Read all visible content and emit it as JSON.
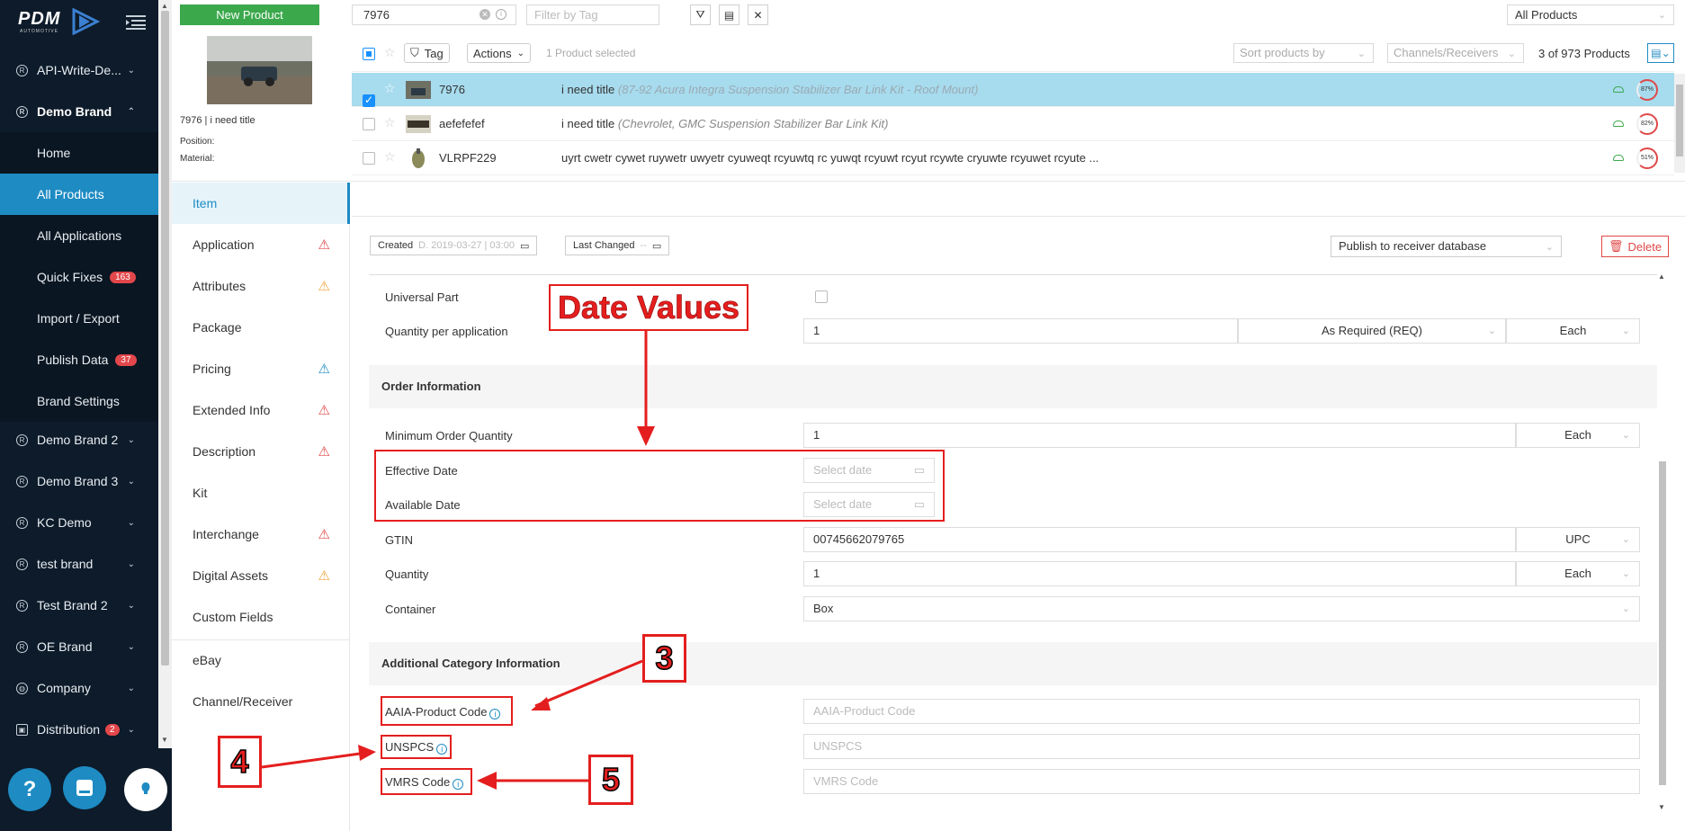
{
  "sidebar": {
    "logo": "PDM",
    "logo_sub": "AUTOMOTIVE",
    "brands": [
      {
        "label": "API-Write-De..."
      },
      {
        "label": "Demo Brand"
      },
      {
        "label": "Demo Brand 2"
      },
      {
        "label": "Demo Brand 3"
      },
      {
        "label": "KC Demo"
      },
      {
        "label": "test brand"
      },
      {
        "label": "Test Brand 2"
      },
      {
        "label": "OE Brand"
      },
      {
        "label": "Company"
      },
      {
        "label": "Distribution",
        "badge": "2"
      }
    ],
    "sub_items": [
      {
        "label": "Home"
      },
      {
        "label": "All Products"
      },
      {
        "label": "All Applications"
      },
      {
        "label": "Quick Fixes",
        "badge": "163"
      },
      {
        "label": "Import / Export"
      },
      {
        "label": "Publish Data",
        "badge": "37"
      },
      {
        "label": "Brand Settings"
      }
    ]
  },
  "topbar": {
    "new_product": "New Product",
    "search_value": "7976",
    "tag_placeholder": "Filter by Tag",
    "view_select": "All Products"
  },
  "product_panel": {
    "title": "7976 | i need title",
    "position_label": "Position:",
    "material_label": "Material:"
  },
  "list_header": {
    "tag_btn": "Tag",
    "actions_btn": "Actions",
    "selected_text": "1 Product selected",
    "sort_placeholder": "Sort products by",
    "channels_placeholder": "Channels/Receivers",
    "count_text": "3 of 973 Products"
  },
  "products": [
    {
      "part": "7976",
      "title": "i need title",
      "subtitle": "(87-92 Acura Integra Suspension Stabilizer Bar Link Kit - Roof Mount)",
      "percent": "87%",
      "selected": true
    },
    {
      "part": "aefefefef",
      "title": "i need title",
      "subtitle": "(Chevrolet, GMC Suspension Stabilizer Bar Link Kit)",
      "percent": "82%",
      "selected": false
    },
    {
      "part": "VLRPF229",
      "title": "uyrt cwetr cywet ruywetr uwyetr cyuweqt rcyuwtq rc yuwqt rcyuwt rcyut rcywte cryuwte rcyuwet rcyute ...",
      "subtitle": "",
      "percent": "51%",
      "selected": false
    }
  ],
  "tabs": [
    {
      "label": "Item",
      "warn": ""
    },
    {
      "label": "Application",
      "warn": "red"
    },
    {
      "label": "Attributes",
      "warn": "orange"
    },
    {
      "label": "Package",
      "warn": ""
    },
    {
      "label": "Pricing",
      "warn": "blue"
    },
    {
      "label": "Extended Info",
      "warn": "red"
    },
    {
      "label": "Description",
      "warn": "red"
    },
    {
      "label": "Kit",
      "warn": ""
    },
    {
      "label": "Interchange",
      "warn": "red"
    },
    {
      "label": "Digital Assets",
      "warn": "orange"
    },
    {
      "label": "Custom Fields",
      "warn": ""
    },
    {
      "label": "eBay",
      "warn": ""
    },
    {
      "label": "Channel/Receiver",
      "warn": ""
    }
  ],
  "form": {
    "created_label": "Created",
    "created_value": "D. 2019-03-27 | 03:00",
    "last_changed_label": "Last Changed",
    "last_changed_value": "--",
    "publish_select": "Publish to receiver database",
    "delete_btn": "Delete",
    "universal_part": "Universal Part",
    "qty_per_app": "Quantity per application",
    "qty_per_app_value": "1",
    "qty_per_app_type": "As Required (REQ)",
    "qty_per_app_unit": "Each",
    "order_info": "Order Information",
    "min_order_qty": "Minimum Order Quantity",
    "min_order_qty_value": "1",
    "min_order_qty_unit": "Each",
    "effective_date": "Effective Date",
    "available_date": "Available Date",
    "date_placeholder": "Select date",
    "gtin": "GTIN",
    "gtin_value": "00745662079765",
    "gtin_type": "UPC",
    "quantity": "Quantity",
    "quantity_value": "1",
    "quantity_unit": "Each",
    "container": "Container",
    "container_value": "Box",
    "additional_info": "Additional Category Information",
    "aaia_label": "AAIA-Product Code",
    "aaia_placeholder": "AAIA-Product Code",
    "unspcs_label": "UNSPCS",
    "unspcs_placeholder": "UNSPCS",
    "vmrs_label": "VMRS Code",
    "vmrs_placeholder": "VMRS Code"
  },
  "annotations": {
    "date_values": "Date Values",
    "n3": "3",
    "n4": "4",
    "n5": "5"
  },
  "colors": {
    "sidebar_bg": "#0d1b2a",
    "accent": "#1e8bc3",
    "new_product_green": "#3aa84b",
    "annotation_red": "#e41e1e",
    "selected_row": "#a7dbee"
  }
}
